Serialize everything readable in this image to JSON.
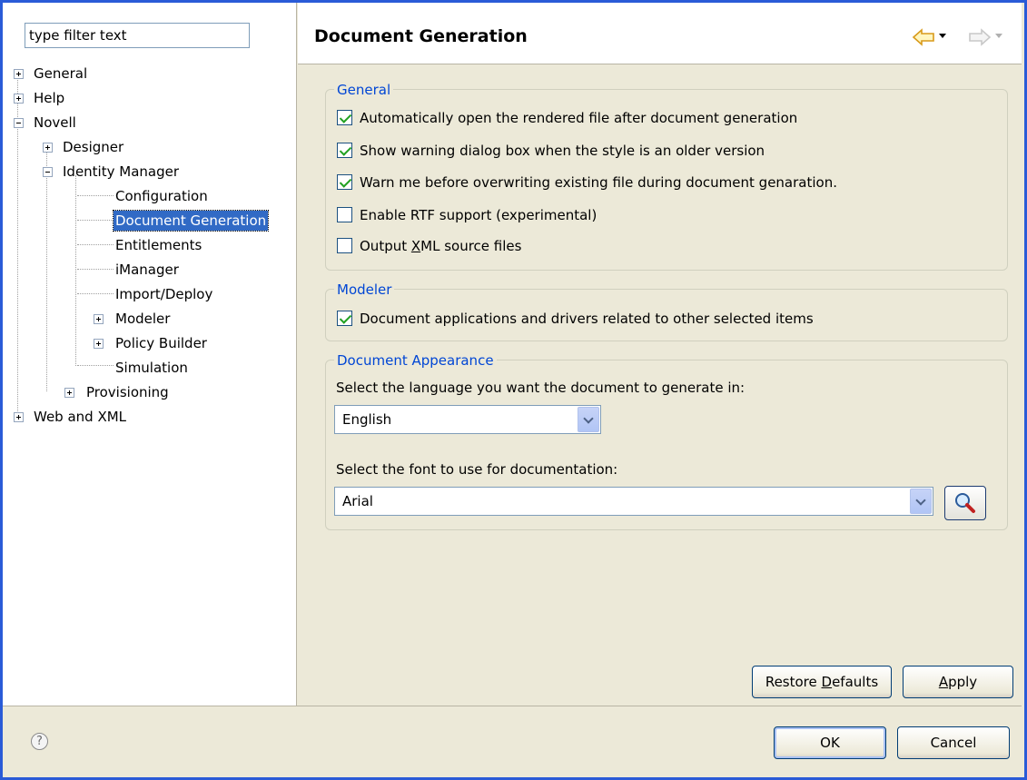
{
  "filter": {
    "value": "type filter text"
  },
  "tree": {
    "general": "General",
    "help": "Help",
    "novell": "Novell",
    "designer": "Designer",
    "identity_manager": "Identity Manager",
    "configuration": "Configuration",
    "document_generation": "Document Generation",
    "entitlements": "Entitlements",
    "imanager": "iManager",
    "import_deploy": "Import/Deploy",
    "modeler": "Modeler",
    "policy_builder": "Policy Builder",
    "simulation": "Simulation",
    "provisioning": "Provisioning",
    "web_and_xml": "Web and XML"
  },
  "header": {
    "title": "Document Generation"
  },
  "general_group": {
    "title": "General",
    "auto_open": {
      "label": "Automatically open the rendered file after document generation",
      "checked": true
    },
    "show_warning": {
      "label": "Show warning dialog box when the style is an older version",
      "checked": true
    },
    "warn_overwrite": {
      "label": "Warn me before overwriting existing file during document genaration.",
      "checked": true
    },
    "enable_rtf": {
      "label": "Enable RTF support (experimental)",
      "checked": false
    },
    "output_xml_pre": "Output ",
    "output_xml_u": "X",
    "output_xml_post": "ML source files",
    "output_xml_checked": false
  },
  "modeler_group": {
    "title": "Modeler",
    "doc_apps": {
      "label": "Document applications and drivers related to other selected items",
      "checked": true
    }
  },
  "appearance_group": {
    "title": "Document Appearance",
    "language_prompt": "Select the language you want the document to generate in:",
    "language_value": "English",
    "font_prompt": "Select the font to use for documentation:",
    "font_value": "Arial"
  },
  "buttons": {
    "restore_pre": "Restore ",
    "restore_u": "D",
    "restore_post": "efaults",
    "apply_u": "A",
    "apply_post": "pply",
    "ok": "OK",
    "cancel": "Cancel"
  },
  "help_glyph": "?",
  "colors": {
    "selection": "#316ac5",
    "group_title": "#0046d5",
    "frame": "#2a5bd7"
  }
}
